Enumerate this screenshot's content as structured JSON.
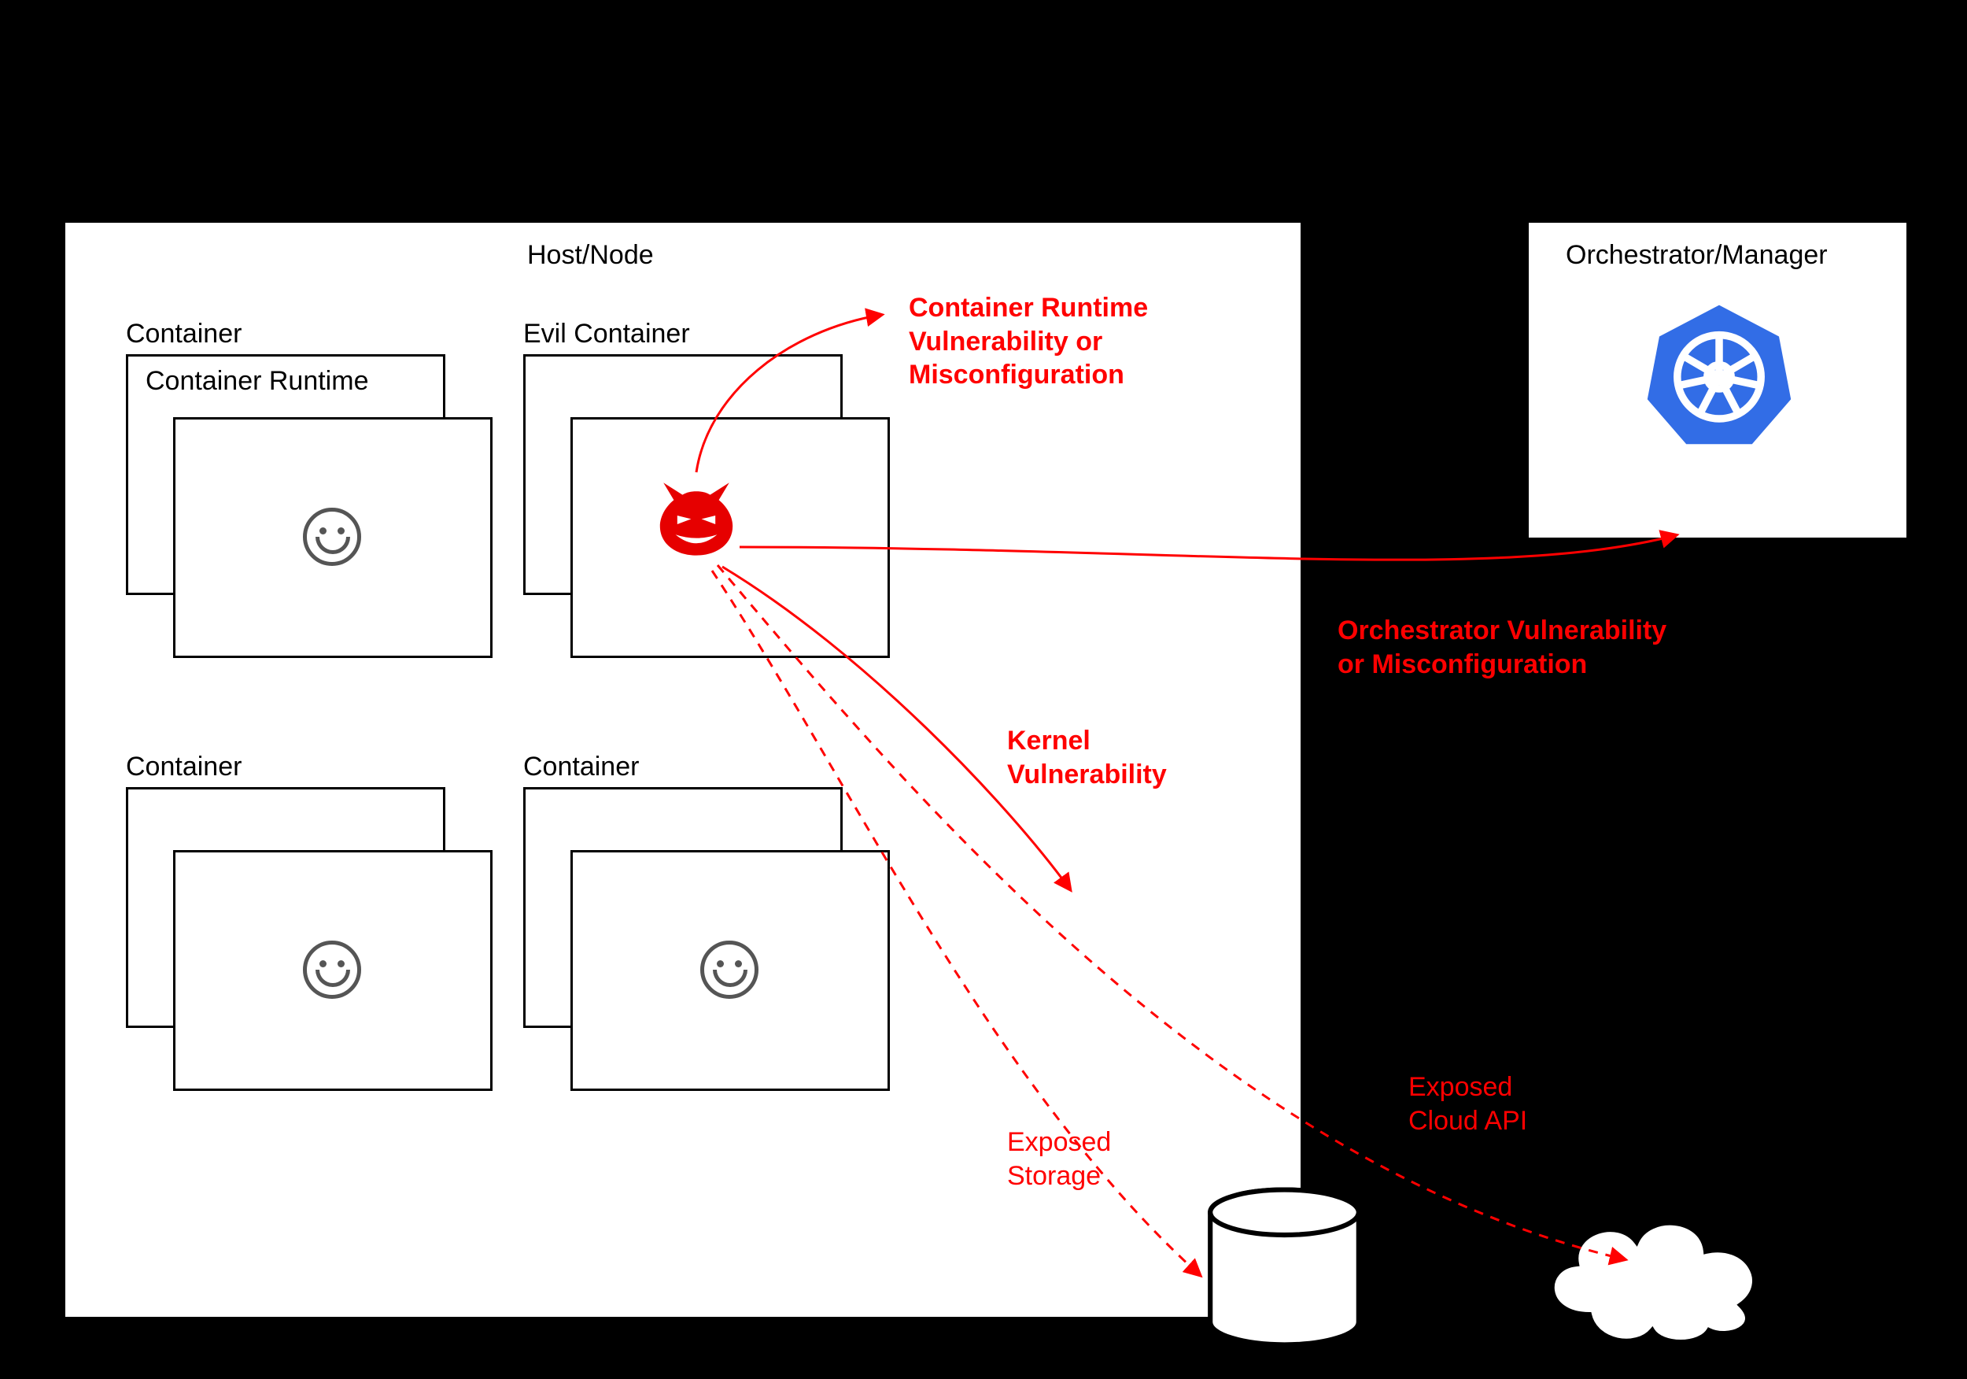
{
  "host": {
    "title": "Host/Node"
  },
  "orchestrator": {
    "title": "Orchestrator/Manager"
  },
  "containers": {
    "topLeft": {
      "label": "Container",
      "runtimeLabel": "Container Runtime"
    },
    "topRight": {
      "label": "Evil Container"
    },
    "bottomLeft": {
      "label": "Container"
    },
    "bottomRight": {
      "label": "Container"
    }
  },
  "threats": {
    "runtime": "Container Runtime\nVulnerability or\nMisconfiguration",
    "orchestrator": "Orchestrator Vulnerability\nor Misconfiguration",
    "kernel": "Kernel\nVulnerability",
    "storage": "Exposed\nStorage",
    "cloud": "Exposed\nCloud API"
  },
  "colors": {
    "threat": "#ff0000",
    "k8s": "#326de6"
  }
}
